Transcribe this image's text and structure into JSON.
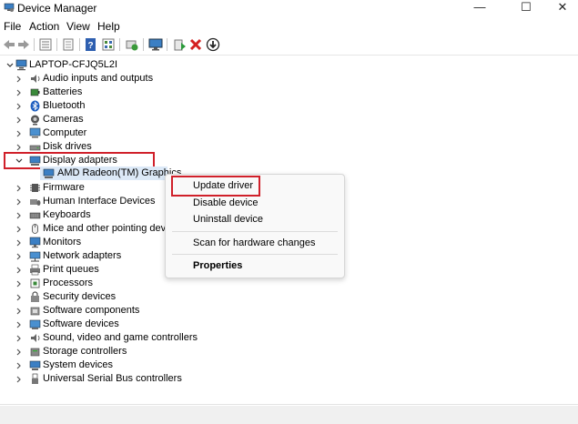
{
  "window": {
    "title": "Device Manager",
    "minimize_glyph": "—",
    "maximize_glyph": "☐",
    "close_glyph": "✕"
  },
  "menu": {
    "file": "File",
    "action": "Action",
    "view": "View",
    "help": "Help"
  },
  "tree": {
    "root": "LAPTOP-CFJQ5L2I",
    "categories": [
      {
        "label": "Audio inputs and outputs",
        "icon": "speaker-icon"
      },
      {
        "label": "Batteries",
        "icon": "battery-icon"
      },
      {
        "label": "Bluetooth",
        "icon": "bluetooth-icon"
      },
      {
        "label": "Cameras",
        "icon": "camera-icon"
      },
      {
        "label": "Computer",
        "icon": "computer-icon"
      },
      {
        "label": "Disk drives",
        "icon": "disk-drive-icon"
      },
      {
        "label": "Display adapters",
        "icon": "display-adapter-icon"
      },
      {
        "label": "Firmware",
        "icon": "firmware-icon"
      },
      {
        "label": "Human Interface Devices",
        "icon": "hid-icon"
      },
      {
        "label": "Keyboards",
        "icon": "keyboard-icon"
      },
      {
        "label": "Mice and other pointing devices",
        "icon": "mouse-icon"
      },
      {
        "label": "Monitors",
        "icon": "monitor-icon"
      },
      {
        "label": "Network adapters",
        "icon": "network-icon"
      },
      {
        "label": "Print queues",
        "icon": "printer-icon"
      },
      {
        "label": "Processors",
        "icon": "processor-icon"
      },
      {
        "label": "Security devices",
        "icon": "security-icon"
      },
      {
        "label": "Software components",
        "icon": "software-component-icon"
      },
      {
        "label": "Software devices",
        "icon": "software-device-icon"
      },
      {
        "label": "Sound, video and game controllers",
        "icon": "sound-icon"
      },
      {
        "label": "Storage controllers",
        "icon": "storage-icon"
      },
      {
        "label": "System devices",
        "icon": "system-icon"
      },
      {
        "label": "Universal Serial Bus controllers",
        "icon": "usb-icon"
      }
    ],
    "display_child": "AMD Radeon(TM) Graphics"
  },
  "context_menu": {
    "update_driver": "Update driver",
    "disable_device": "Disable device",
    "uninstall_device": "Uninstall device",
    "scan": "Scan for hardware changes",
    "properties": "Properties"
  },
  "colors": {
    "highlight": "#d0202a",
    "selection": "#dce9f7"
  }
}
